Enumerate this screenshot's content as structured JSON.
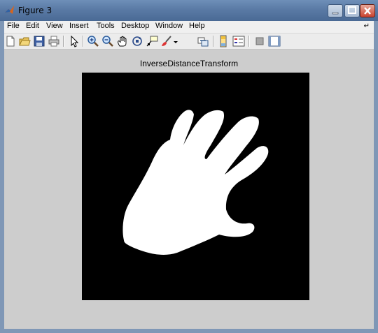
{
  "window": {
    "title": "Figure 3"
  },
  "menubar": {
    "items": [
      "File",
      "Edit",
      "View",
      "Insert",
      "Tools",
      "Desktop",
      "Window",
      "Help"
    ]
  },
  "toolbar": {
    "tools": [
      "new-figure",
      "open-file",
      "save",
      "print",
      "edit-plot",
      "zoom-in",
      "zoom-out",
      "pan",
      "rotate-3d",
      "data-cursor",
      "brush",
      "link-plot",
      "colorbar",
      "legend",
      "hide-plot-tools",
      "show-plot-tools"
    ]
  },
  "figure": {
    "axes_title": "InverseDistanceTransform",
    "image": "white hand silhouette on black background"
  },
  "colors": {
    "titlebar": "#5a7aa5",
    "figure_bg": "#cdcdcd",
    "axes_bg": "#000000",
    "shape": "#ffffff"
  }
}
